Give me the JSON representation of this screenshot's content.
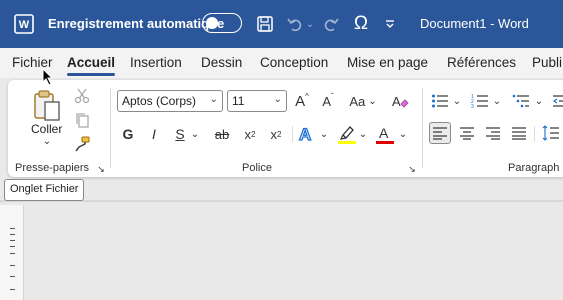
{
  "titlebar": {
    "autosave_label": "Enregistrement automatique",
    "document_title": "Document1 - Word",
    "accent": "#2b579a"
  },
  "tabs": [
    "Fichier",
    "Accueil",
    "Insertion",
    "Dessin",
    "Conception",
    "Mise en page",
    "Références",
    "Publi"
  ],
  "active_tab": "Accueil",
  "ribbon": {
    "clipboard": {
      "paste_label": "Coller",
      "group_label": "Presse-papiers"
    },
    "font": {
      "font_name": "Aptos (Corps)",
      "font_size": "11",
      "group_label": "Police",
      "bold": "G",
      "italic": "I",
      "underline": "S",
      "strike": "ab",
      "subscript": "x",
      "subscript_mark": "2",
      "superscript": "x",
      "superscript_mark": "2",
      "case": "Aa",
      "grow": "A",
      "shrink": "A",
      "highlight_color": "#ffff00",
      "font_color": "#e00000"
    },
    "paragraph": {
      "group_label": "Paragraph"
    }
  },
  "tooltip": "Onglet Fichier"
}
